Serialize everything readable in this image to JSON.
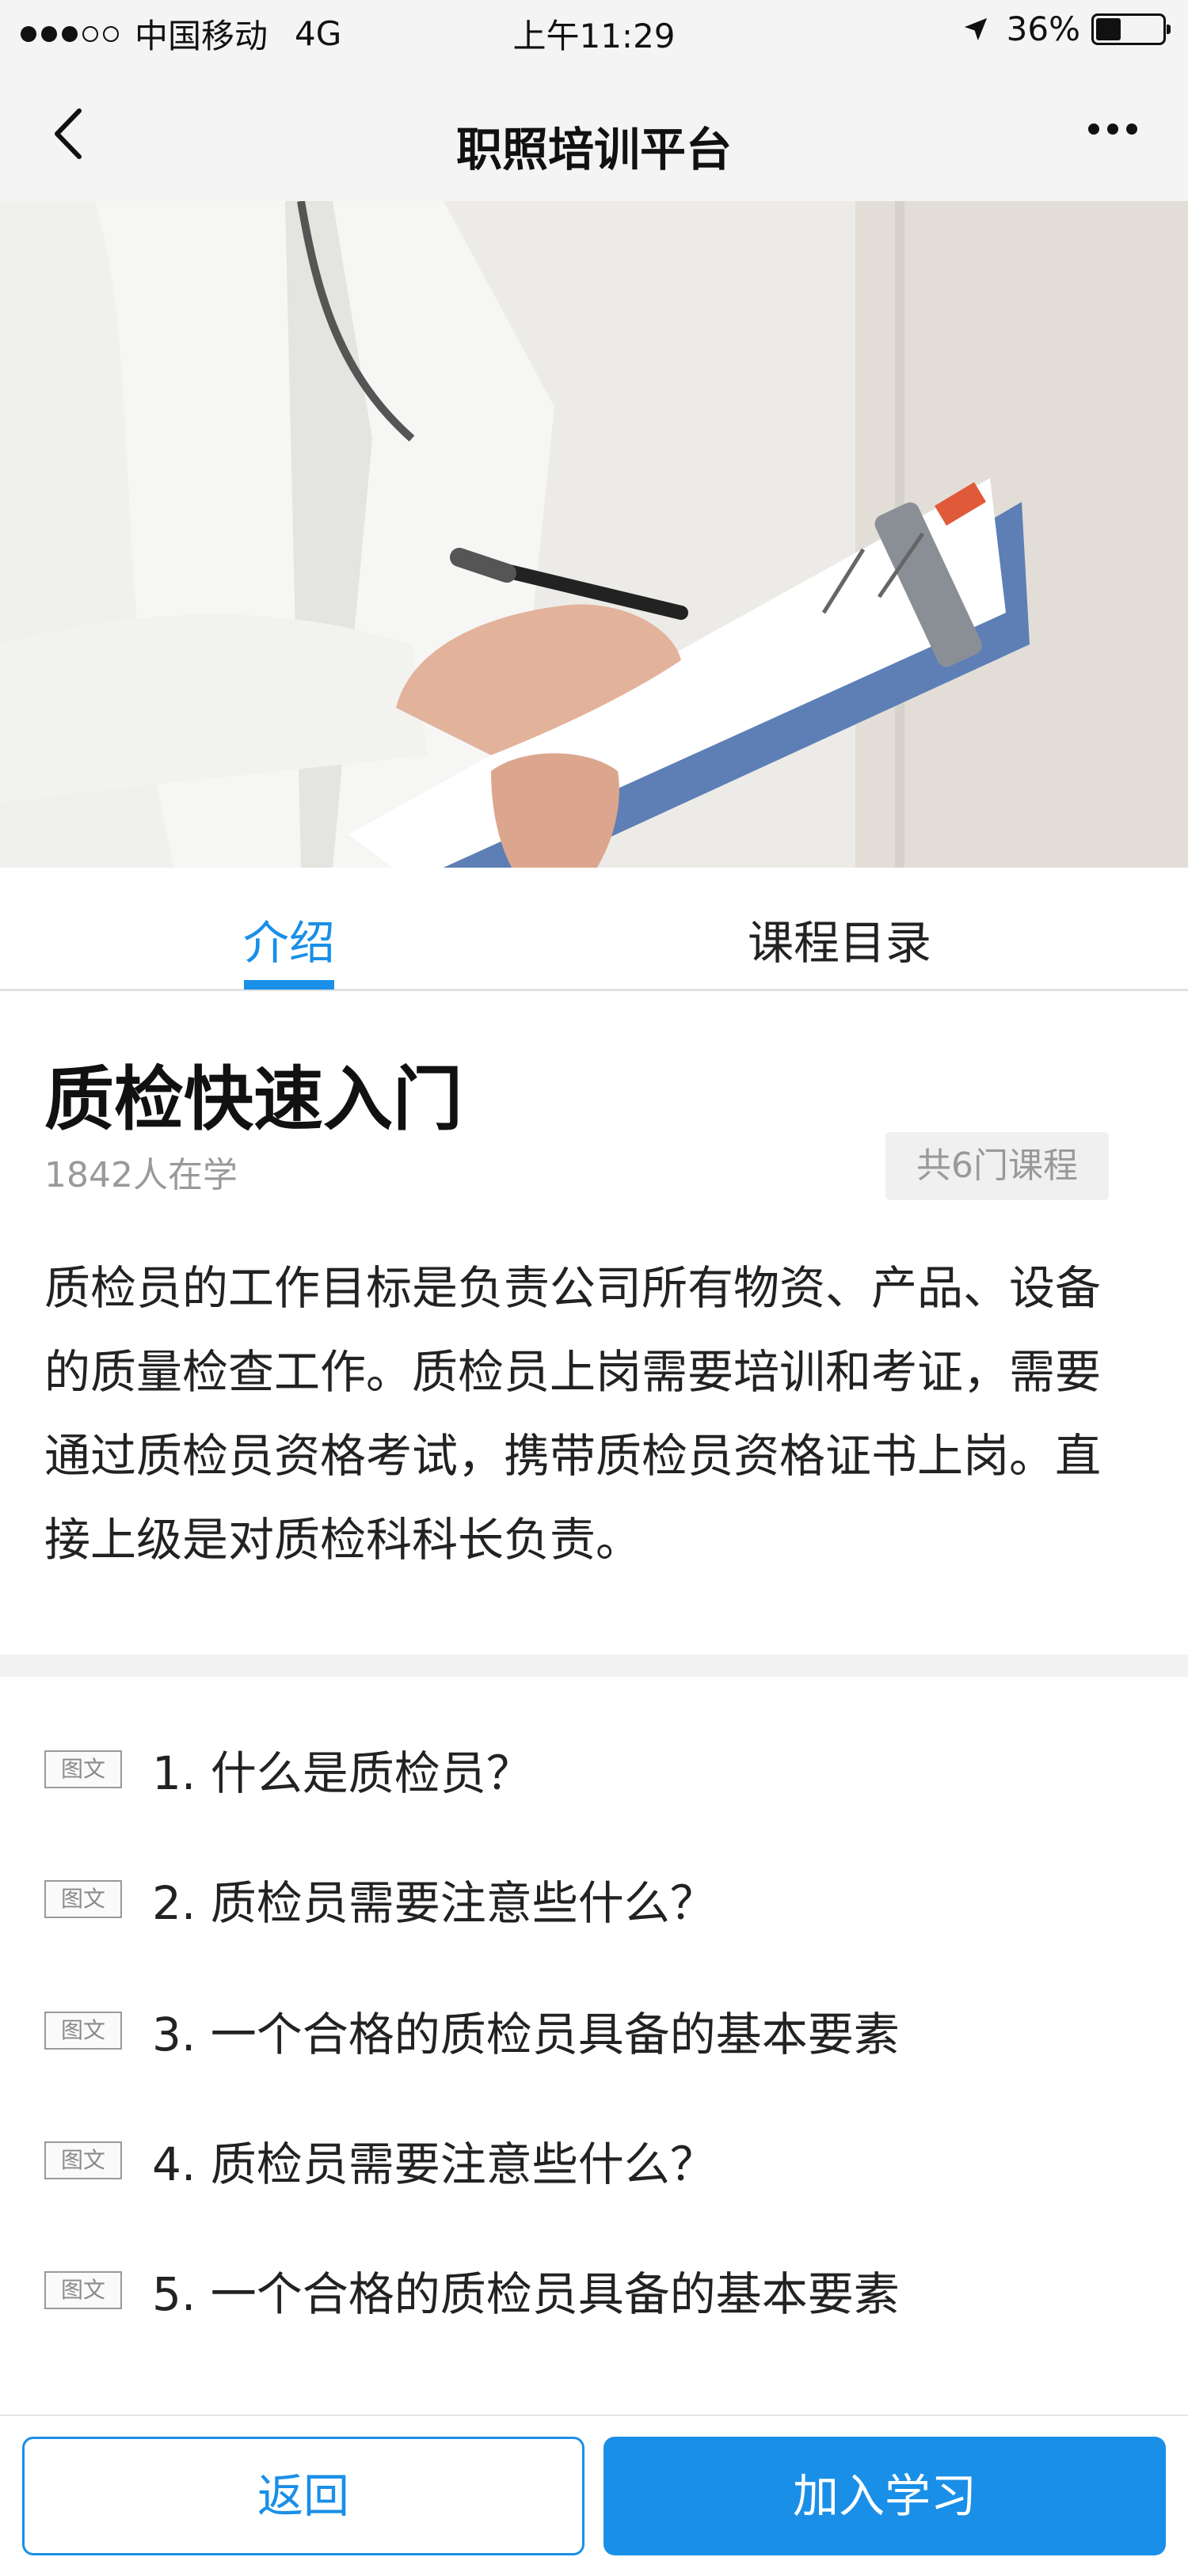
{
  "status_bar": {
    "carrier": "中国移动",
    "network": "4G",
    "time": "上午11:29",
    "battery": "36%",
    "battery_level": 0.36
  },
  "nav": {
    "title": "职照培训平台",
    "back_icon": "chevron-left-icon",
    "more_icon": "more-dots-icon"
  },
  "tabs": [
    {
      "label": "介绍",
      "active": true
    },
    {
      "label": "课程目录",
      "active": false
    }
  ],
  "intro": {
    "title": "质检快速入门",
    "learners": "1842人在学",
    "course_count": "共6门课程",
    "description": "质检员的工作目标是负责公司所有物资、产品、设备的质量检查工作。质检员上岗需要培训和考证，需要通过质检员资格考试，携带质检员资格证书上岗。直接上级是对质检科科长负责。"
  },
  "lessons": [
    {
      "tag": "图文",
      "title": "1. 什么是质检员？"
    },
    {
      "tag": "图文",
      "title": "2. 质检员需要注意些什么？"
    },
    {
      "tag": "图文",
      "title": "3. 一个合格的质检员具备的基本要素"
    },
    {
      "tag": "图文",
      "title": "4. 质检员需要注意些什么？"
    },
    {
      "tag": "图文",
      "title": "5. 一个合格的质检员具备的基本要素"
    }
  ],
  "bottom": {
    "back_label": "返回",
    "join_label": "加入学习"
  },
  "colors": {
    "accent": "#1a8fe8",
    "text": "#222222",
    "muted": "#999999"
  }
}
